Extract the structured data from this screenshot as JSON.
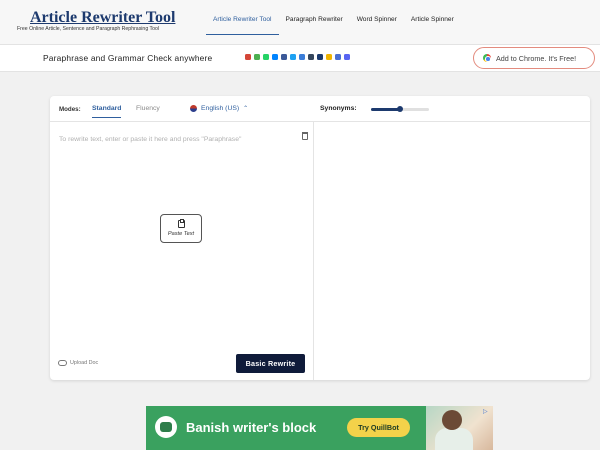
{
  "header": {
    "logo_title": "Article Rewriter Tool",
    "logo_tagline": "Free Online Article, Sentence and Paragraph Rephrasing Tool",
    "nav": [
      {
        "label": "Article Rewriter Tool",
        "active": true
      },
      {
        "label": "Paragraph Rewriter",
        "active": false
      },
      {
        "label": "Word Spinner",
        "active": false
      },
      {
        "label": "Article Spinner",
        "active": false
      }
    ]
  },
  "subbar": {
    "title": "Paraphrase and Grammar Check anywhere",
    "share_icons": [
      {
        "name": "gmail-icon",
        "color": "#d44638"
      },
      {
        "name": "share-icon",
        "color": "#4caf50"
      },
      {
        "name": "whatsapp-icon",
        "color": "#25d366"
      },
      {
        "name": "messenger-icon",
        "color": "#0084ff"
      },
      {
        "name": "facebook-icon",
        "color": "#3b5998"
      },
      {
        "name": "twitter-icon",
        "color": "#1da1f2"
      },
      {
        "name": "bookmark-icon",
        "color": "#3b7dd8"
      },
      {
        "name": "tumblr-icon",
        "color": "#35465c"
      },
      {
        "name": "x-icon",
        "color": "#1b3a6e"
      },
      {
        "name": "note-icon",
        "color": "#f0b400"
      },
      {
        "name": "print-icon",
        "color": "#4a6fd1"
      },
      {
        "name": "discord-icon",
        "color": "#5865f2"
      }
    ],
    "chrome_button": "Add to Chrome. It's Free!"
  },
  "editor": {
    "modes_label": "Modes:",
    "modes": [
      {
        "label": "Standard",
        "active": true
      },
      {
        "label": "Fluency",
        "active": false
      }
    ],
    "language": "English (US)",
    "synonyms_label": "Synonyms:",
    "synonyms_level": 0.5,
    "input_placeholder": "To rewrite text, enter or paste it here and press \"Paraphrase\"",
    "paste_label": "Paste Text",
    "upload_label": "Upload Doc",
    "rewrite_button": "Basic Rewrite"
  },
  "ad": {
    "headline": "Banish writer's block",
    "cta": "Try QuillBot",
    "brand_color": "#3aa15f"
  }
}
